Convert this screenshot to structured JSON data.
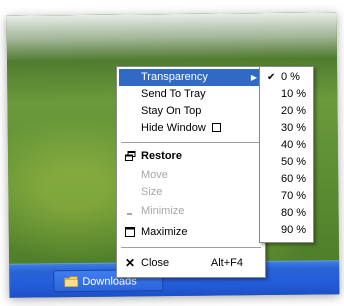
{
  "taskbar": {
    "button_label": "Downloads",
    "icon": "folder-icon"
  },
  "context_menu": {
    "items": [
      {
        "label": "Transparency",
        "state": "highlighted",
        "has_submenu": true
      },
      {
        "label": "Send To Tray"
      },
      {
        "label": "Stay On Top"
      },
      {
        "label": "Hide Window"
      },
      {
        "label": "Restore",
        "bold": true,
        "icon": "restore-icon"
      },
      {
        "label": "Move",
        "state": "disabled"
      },
      {
        "label": "Size",
        "state": "disabled"
      },
      {
        "label": "Minimize",
        "state": "disabled",
        "icon": "minimize-icon"
      },
      {
        "label": "Maximize",
        "icon": "maximize-icon"
      },
      {
        "label": "Close",
        "accelerator": "Alt+F4",
        "icon": "close-icon"
      }
    ]
  },
  "transparency_submenu": {
    "options": [
      "0 %",
      "10 %",
      "20 %",
      "30 %",
      "40 %",
      "50 %",
      "60 %",
      "70 %",
      "80 %",
      "90 %"
    ],
    "selected": "0 %"
  },
  "colors": {
    "highlight": "#316ac5",
    "taskbar": "#245dda",
    "disabled_text": "#a7a6aa"
  }
}
